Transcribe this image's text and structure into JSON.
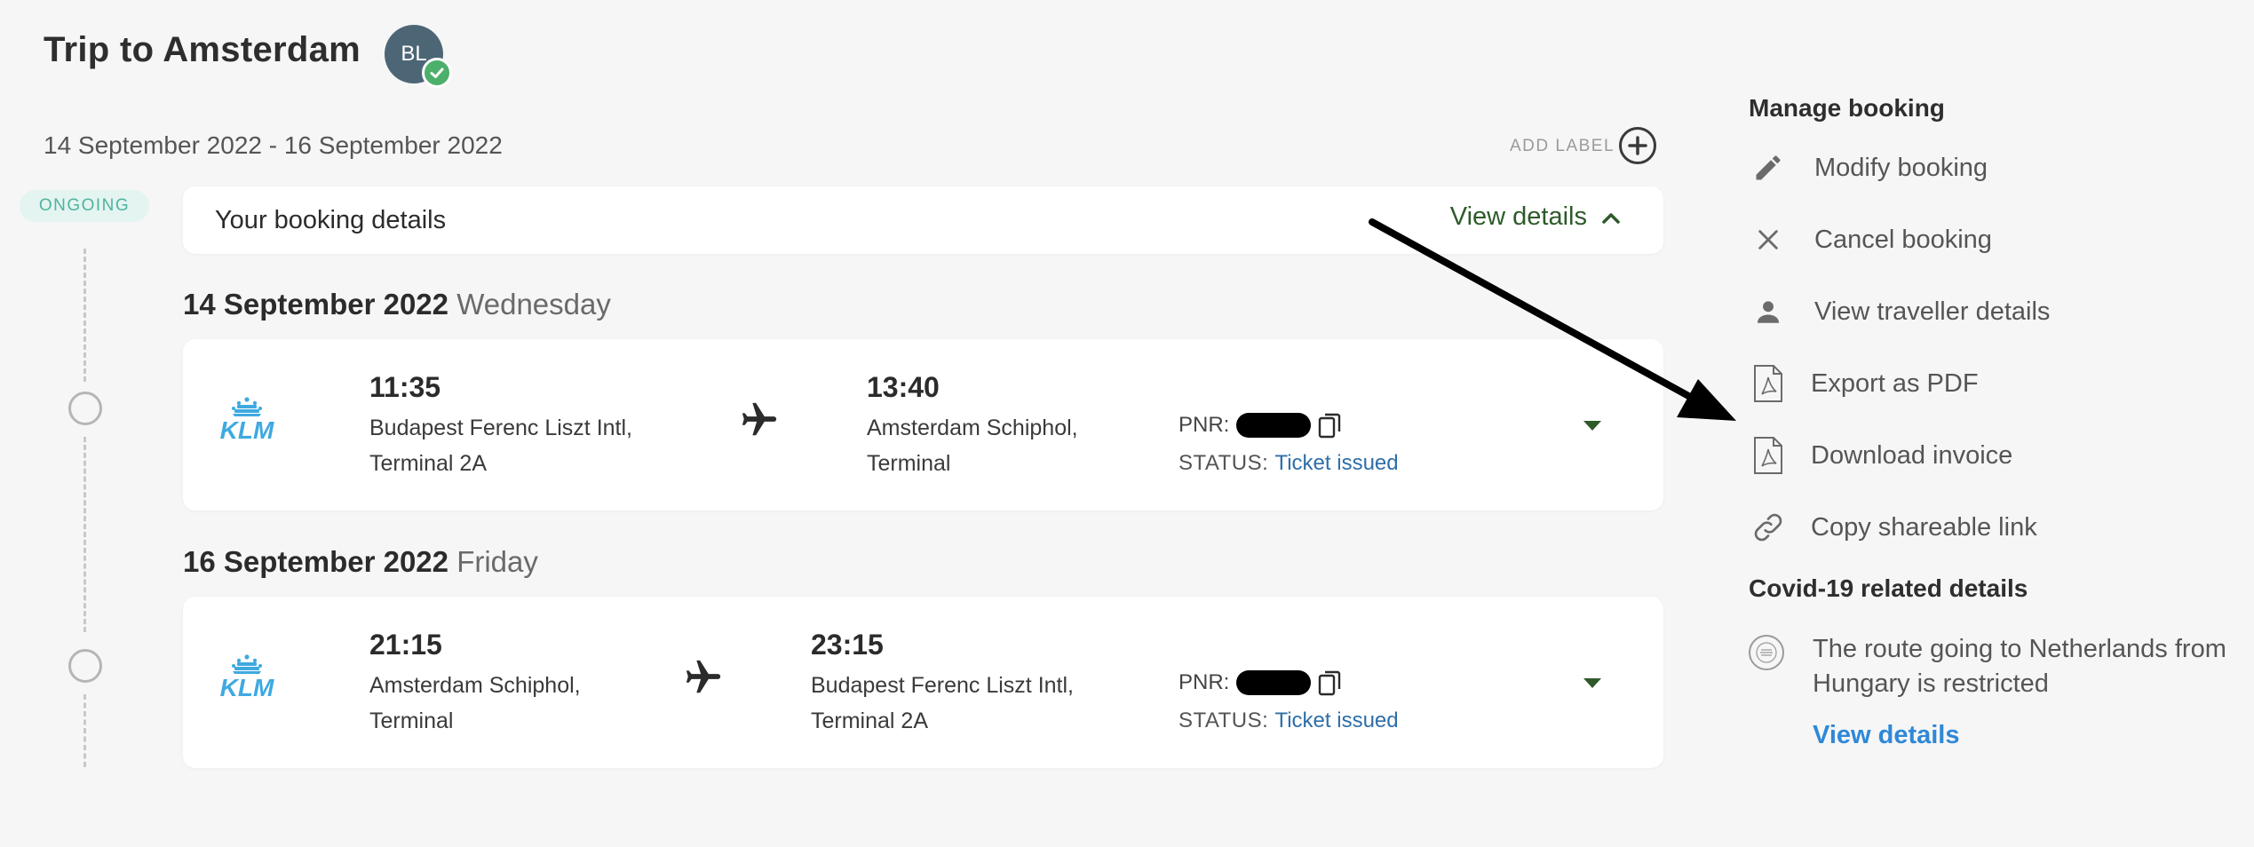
{
  "trip": {
    "title": "Trip to Amsterdam",
    "avatar_initials": "BL",
    "dates": "14 September 2022 - 16 September 2022",
    "add_label": "ADD LABEL",
    "status_badge": "ONGOING"
  },
  "booking_bar": {
    "label": "Your booking details",
    "view_details": "View details"
  },
  "days": [
    {
      "date": "14 September 2022",
      "weekday": "Wednesday",
      "flight": {
        "airline": "KLM",
        "dep_time": "11:35",
        "dep_place_line1": "Budapest Ferenc Liszt Intl,",
        "dep_place_line2": "Terminal 2A",
        "arr_time": "13:40",
        "arr_place_line1": "Amsterdam Schiphol,",
        "arr_place_line2": "Terminal",
        "pnr_label": "PNR:",
        "status_label": "STATUS:",
        "status_value": "Ticket issued"
      }
    },
    {
      "date": "16 September 2022",
      "weekday": "Friday",
      "flight": {
        "airline": "KLM",
        "dep_time": "21:15",
        "dep_place_line1": "Amsterdam Schiphol,",
        "dep_place_line2": "Terminal",
        "arr_time": "23:15",
        "arr_place_line1": "Budapest Ferenc Liszt Intl,",
        "arr_place_line2": "Terminal 2A",
        "pnr_label": "PNR:",
        "status_label": "STATUS:",
        "status_value": "Ticket issued"
      }
    }
  ],
  "manage": {
    "heading": "Manage booking",
    "items": [
      {
        "label": "Modify booking",
        "icon": "pencil-icon"
      },
      {
        "label": "Cancel booking",
        "icon": "close-icon"
      },
      {
        "label": "View traveller details",
        "icon": "person-icon"
      },
      {
        "label": "Export as PDF",
        "icon": "pdf-icon"
      },
      {
        "label": "Download invoice",
        "icon": "pdf-icon"
      },
      {
        "label": "Copy shareable link",
        "icon": "link-icon"
      }
    ]
  },
  "covid": {
    "heading": "Covid-19 related details",
    "text": "The route going to Netherlands from Hungary is restricted",
    "link": "View details"
  },
  "colors": {
    "accent_green": "#2e5a2a",
    "link_blue": "#2f88d8",
    "status_blue": "#2e6ea8",
    "klm_blue": "#3fa9e0",
    "ongoing_teal": "#4fb3a1"
  }
}
